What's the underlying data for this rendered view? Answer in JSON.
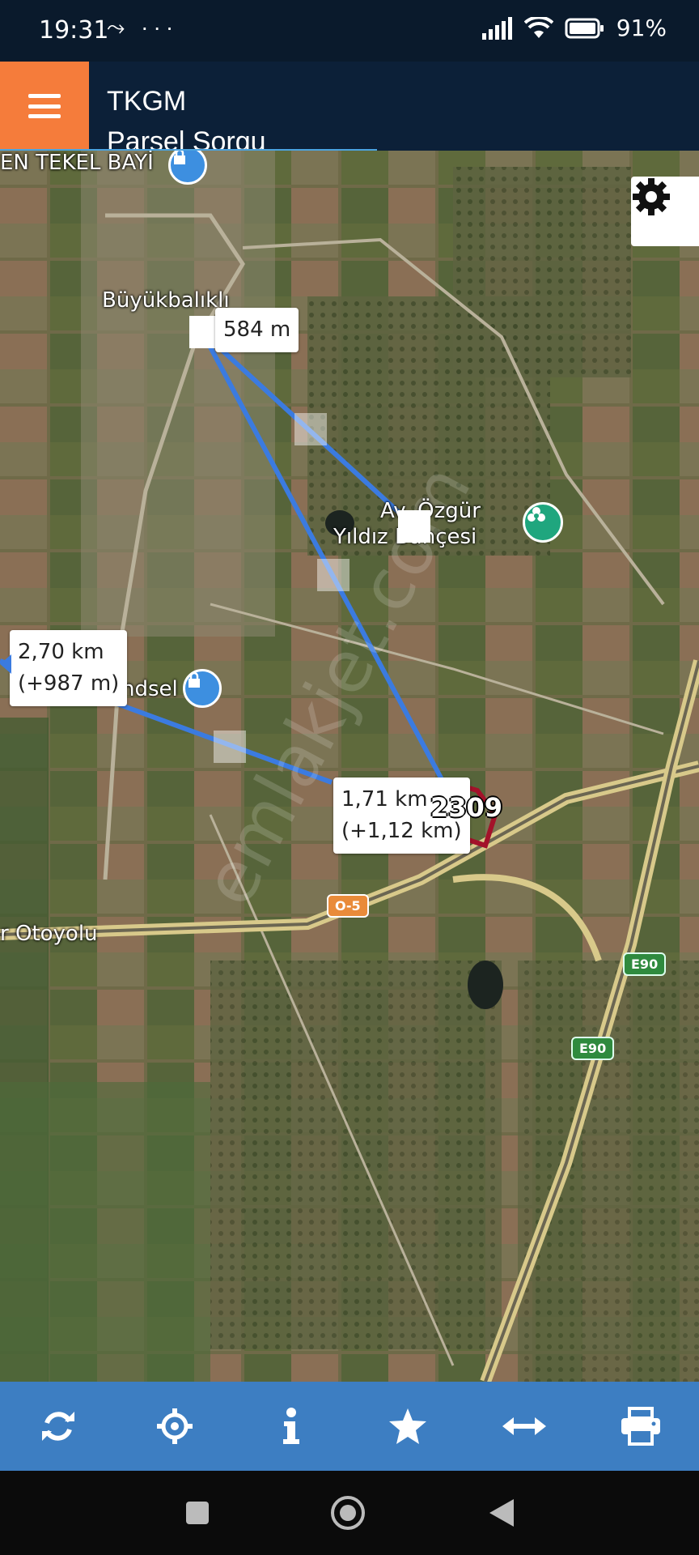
{
  "status_bar": {
    "time": "19:31",
    "left_icons": "⤳ ···",
    "battery": "91%"
  },
  "header": {
    "title": "TKGM",
    "subtitle": "Parsel Sorgu",
    "menu_icon": "hamburger-icon",
    "accent": "#f57c3b"
  },
  "map": {
    "place_labels": {
      "village": "Büyükbalıklı",
      "shop": "EN TEKEL BAYİ",
      "garden_line1": "Av. Özgür",
      "garden_line2": "Yıldız Bahçesi",
      "poi_partial": "ndsel",
      "highway": "r Otoyolu"
    },
    "measurements": {
      "segment_1": "584 m",
      "segment_2_line1": "1,71 km",
      "segment_2_line2": "(+1,12 km)",
      "total_line1": "2,70 km",
      "total_line2": "(+987 m)"
    },
    "parcel_number": "2309",
    "road_badges": {
      "o5": "O-5",
      "e90_a": "E90",
      "e90_b": "E90"
    },
    "watermark": "emlakjet.com",
    "measure_line_color": "#3b7be0"
  },
  "toolbar": {
    "items": [
      "refresh-icon",
      "locate-icon",
      "info-icon",
      "star-icon",
      "measure-icon",
      "print-icon"
    ]
  },
  "nav_bar": {
    "items": [
      "recents-icon",
      "home-icon",
      "back-icon"
    ]
  }
}
